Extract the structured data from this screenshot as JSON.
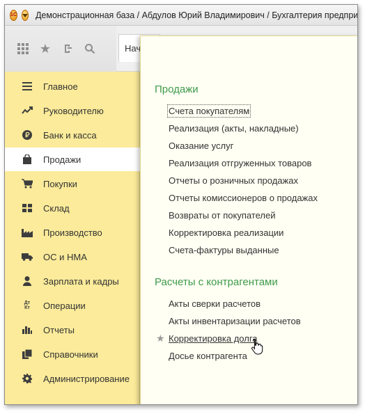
{
  "window": {
    "title": "Демонстрационная база / Абдулов Юрий Владимирович / Бухгалтерия предприятия, р",
    "logo_text": "1С"
  },
  "toolbar": {
    "tab_label": "Нач",
    "icons": [
      "apps-grid-icon",
      "favorites-star-icon",
      "history-icon",
      "search-icon"
    ]
  },
  "sidebar": {
    "items": [
      {
        "label": "Главное",
        "icon": "main-menu-icon"
      },
      {
        "label": "Руководителю",
        "icon": "trend-chart-icon"
      },
      {
        "label": "Банк и касса",
        "icon": "ruble-coin-icon"
      },
      {
        "label": "Продажи",
        "icon": "shopping-bag-icon",
        "active": true
      },
      {
        "label": "Покупки",
        "icon": "shopping-cart-icon"
      },
      {
        "label": "Склад",
        "icon": "warehouse-icon"
      },
      {
        "label": "Производство",
        "icon": "factory-icon"
      },
      {
        "label": "ОС и НМА",
        "icon": "truck-icon"
      },
      {
        "label": "Зарплата и кадры",
        "icon": "person-icon"
      },
      {
        "label": "Операции",
        "icon": "debit-credit-icon"
      },
      {
        "label": "Отчеты",
        "icon": "bar-chart-icon"
      },
      {
        "label": "Справочники",
        "icon": "books-icon"
      },
      {
        "label": "Администрирование",
        "icon": "gear-icon"
      }
    ],
    "operations_icon_text": "Дт Кт"
  },
  "panel": {
    "sections": [
      {
        "title": "Продажи",
        "links": [
          "Счета покупателям",
          "Реализация (акты, накладные)",
          "Оказание услуг",
          "Реализация отгруженных товаров",
          "Отчеты о розничных продажах",
          "Отчеты комиссионеров о продажах",
          "Возвраты от покупателей",
          "Корректировка реализации",
          "Счета-фактуры выданные"
        ]
      },
      {
        "title": "Расчеты с контрагентами",
        "links": [
          "Акты сверки расчетов",
          "Акты инвентаризации расчетов",
          "Корректировка долга",
          "Досье контрагента"
        ]
      }
    ],
    "focused_link": "Счета покупателям",
    "hovered_link": "Корректировка долга",
    "favorite_marker": "★"
  },
  "colors": {
    "sidebar_bg": "#fbeb9a",
    "panel_bg": "#fffff3",
    "section_title": "#3e9a4b",
    "active_item_bg": "#ffffff"
  }
}
